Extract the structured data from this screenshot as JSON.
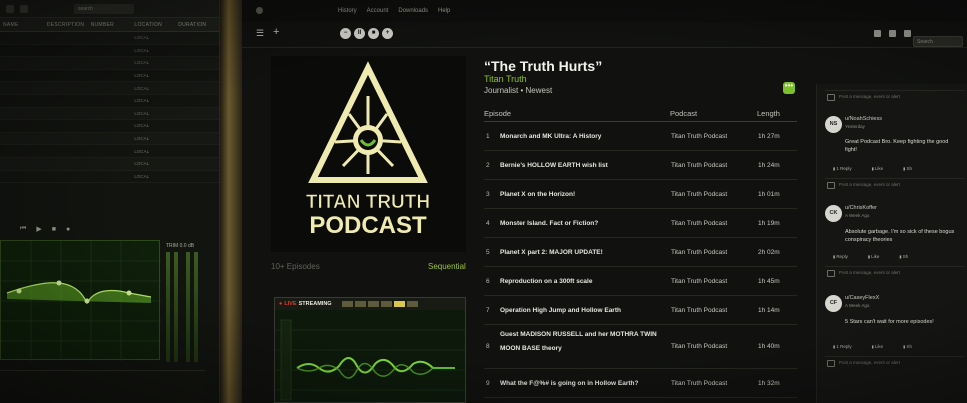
{
  "left_monitor": {
    "search_placeholder": "search",
    "columns": [
      "NAME",
      "DESCRIPTION",
      "NUMBER",
      "LOCATION",
      "DURATION"
    ],
    "rows": [
      [
        "",
        "",
        "",
        "LOCAL",
        ""
      ],
      [
        "",
        "",
        "",
        "LOCAL",
        ""
      ],
      [
        "",
        "",
        "",
        "LOCAL",
        ""
      ],
      [
        "",
        "",
        "",
        "LOCAL",
        ""
      ],
      [
        "",
        "",
        "",
        "LOCAL",
        ""
      ],
      [
        "",
        "",
        "",
        "LOCAL",
        ""
      ],
      [
        "",
        "",
        "",
        "LOCAL",
        ""
      ],
      [
        "",
        "",
        "",
        "LOCAL",
        ""
      ],
      [
        "",
        "",
        "",
        "LOCAL",
        ""
      ],
      [
        "",
        "",
        "",
        "LOCAL",
        ""
      ],
      [
        "",
        "",
        "",
        "LOCAL",
        ""
      ],
      [
        "",
        "",
        "",
        "LOCAL",
        ""
      ]
    ],
    "trim_label": "TRIM",
    "trim_value": "0.0 dB"
  },
  "menubar": {
    "items": [
      "History",
      "Account",
      "Downloads",
      "Help"
    ]
  },
  "toolbar": {
    "search_placeholder": "Search"
  },
  "podcast": {
    "art_line1": "TITAN TRUTH",
    "art_line2": "PODCAST",
    "episodes_count": "10+ Episodes",
    "sort": "Sequential",
    "title": "“The Truth Hurts”",
    "author": "Titan Truth",
    "meta": "Journalist • Newest"
  },
  "stream_widget": {
    "live": "LIVE",
    "label": "STREAMING"
  },
  "episode_list": {
    "headers": {
      "episode": "Episode",
      "podcast": "Podcast",
      "length": "Length"
    },
    "episodes": [
      {
        "num": "1",
        "title": "Monarch and MK Ultra: A History",
        "podcast": "Titan Truth Podcast",
        "length": "1h 27m"
      },
      {
        "num": "2",
        "title": "Bernie’s HOLLOW EARTH wish list",
        "podcast": "Titan Truth Podcast",
        "length": "1h 24m"
      },
      {
        "num": "3",
        "title": "Planet X on the Horizon!",
        "podcast": "Titan Truth Podcast",
        "length": "1h 01m"
      },
      {
        "num": "4",
        "title": "Monster Island. Fact or Fiction?",
        "podcast": "Titan Truth Podcast",
        "length": "1h 19m"
      },
      {
        "num": "5",
        "title": "Planet X part 2: MAJOR UPDATE!",
        "podcast": "Titan Truth Podcast",
        "length": "2h 02m"
      },
      {
        "num": "6",
        "title": "Reproduction on a 300ft scale",
        "podcast": "Titan Truth Podcast",
        "length": "1h 45m"
      },
      {
        "num": "7",
        "title": "Operation High Jump and Hollow Earth",
        "podcast": "Titan Truth Podcast",
        "length": "1h 14m"
      },
      {
        "num": "8",
        "title": "Guest MADISON RUSSELL and her MOTHRA TWIN MOON BASE theory",
        "podcast": "Titan Truth Podcast",
        "length": "1h 40m"
      },
      {
        "num": "9",
        "title": "What the F@%# is going on in Hollow Earth?",
        "podcast": "Titan Truth Podcast",
        "length": "1h 32m"
      }
    ]
  },
  "comments": {
    "input_placeholder": "Post a message, event or alert",
    "items": [
      {
        "initials": "NS",
        "user": "u/NoahSchiess",
        "time": "Yesterday",
        "text": "Great Podcast Bro. Keep fighting the good fight!",
        "reply": "1 Reply",
        "like": "Like",
        "share": "Sh"
      },
      {
        "initials": "CK",
        "user": "u/ChrisKoffer",
        "time": "A Week Ago",
        "text": "Absolute garbage. I'm so sick of these bogus conspiracy theories",
        "reply": "Reply",
        "like": "Like",
        "share": "Sh"
      },
      {
        "initials": "CF",
        "user": "u/CaseyFlexX",
        "time": "A Week Ago",
        "text": "5 Stars can't wait for more episodes!",
        "reply": "1 Reply",
        "like": "Like",
        "share": "Sh"
      }
    ]
  },
  "colors": {
    "accent_green": "#8fbf2f",
    "art_cream": "#efeab0",
    "live_red": "#e03a2a"
  }
}
